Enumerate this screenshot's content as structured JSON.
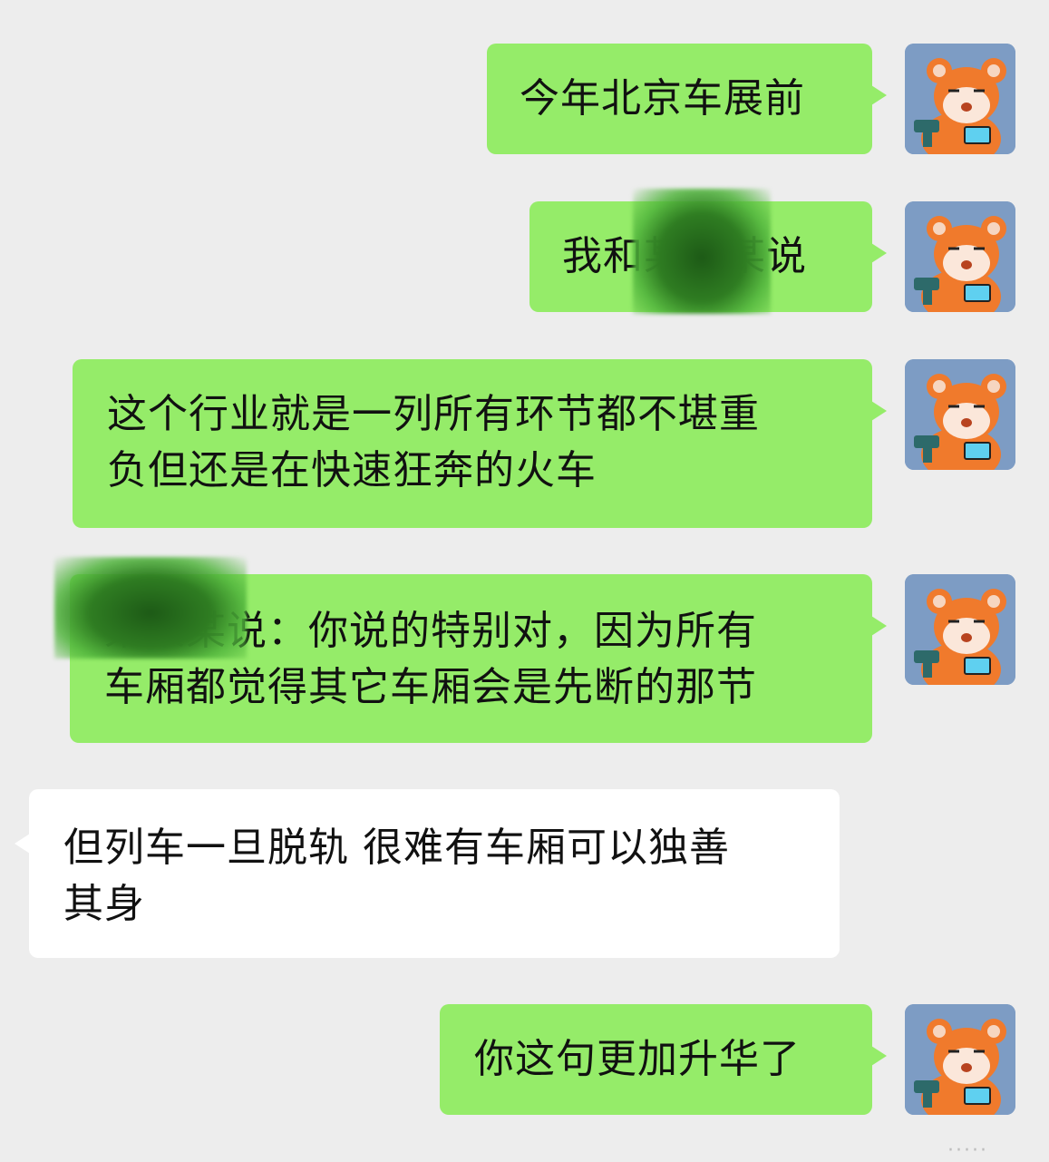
{
  "colors": {
    "background": "#ededed",
    "outgoing_bubble": "#95ec69",
    "incoming_bubble": "#ffffff",
    "avatar_bg": "#7d9cc4"
  },
  "messages": [
    {
      "side": "outgoing",
      "text": "今年北京车展前"
    },
    {
      "side": "outgoing",
      "text": "我和某某某说"
    },
    {
      "side": "outgoing",
      "text": "这个行业就是一列所有环节都不堪重\n负但还是在快速狂奔的火车"
    },
    {
      "side": "outgoing",
      "text": "某某某说：你说的特别对，因为所有\n车厢都觉得其它车厢会是先断的那节"
    },
    {
      "side": "incoming",
      "text": "但列车一旦脱轨 很难有车厢可以独善\n其身"
    },
    {
      "side": "outgoing",
      "text": "你这句更加升华了"
    }
  ],
  "avatar_icon": "red-panda-avatar-icon",
  "redaction_icon": "redaction-scribble",
  "watermark_dots": "·····"
}
